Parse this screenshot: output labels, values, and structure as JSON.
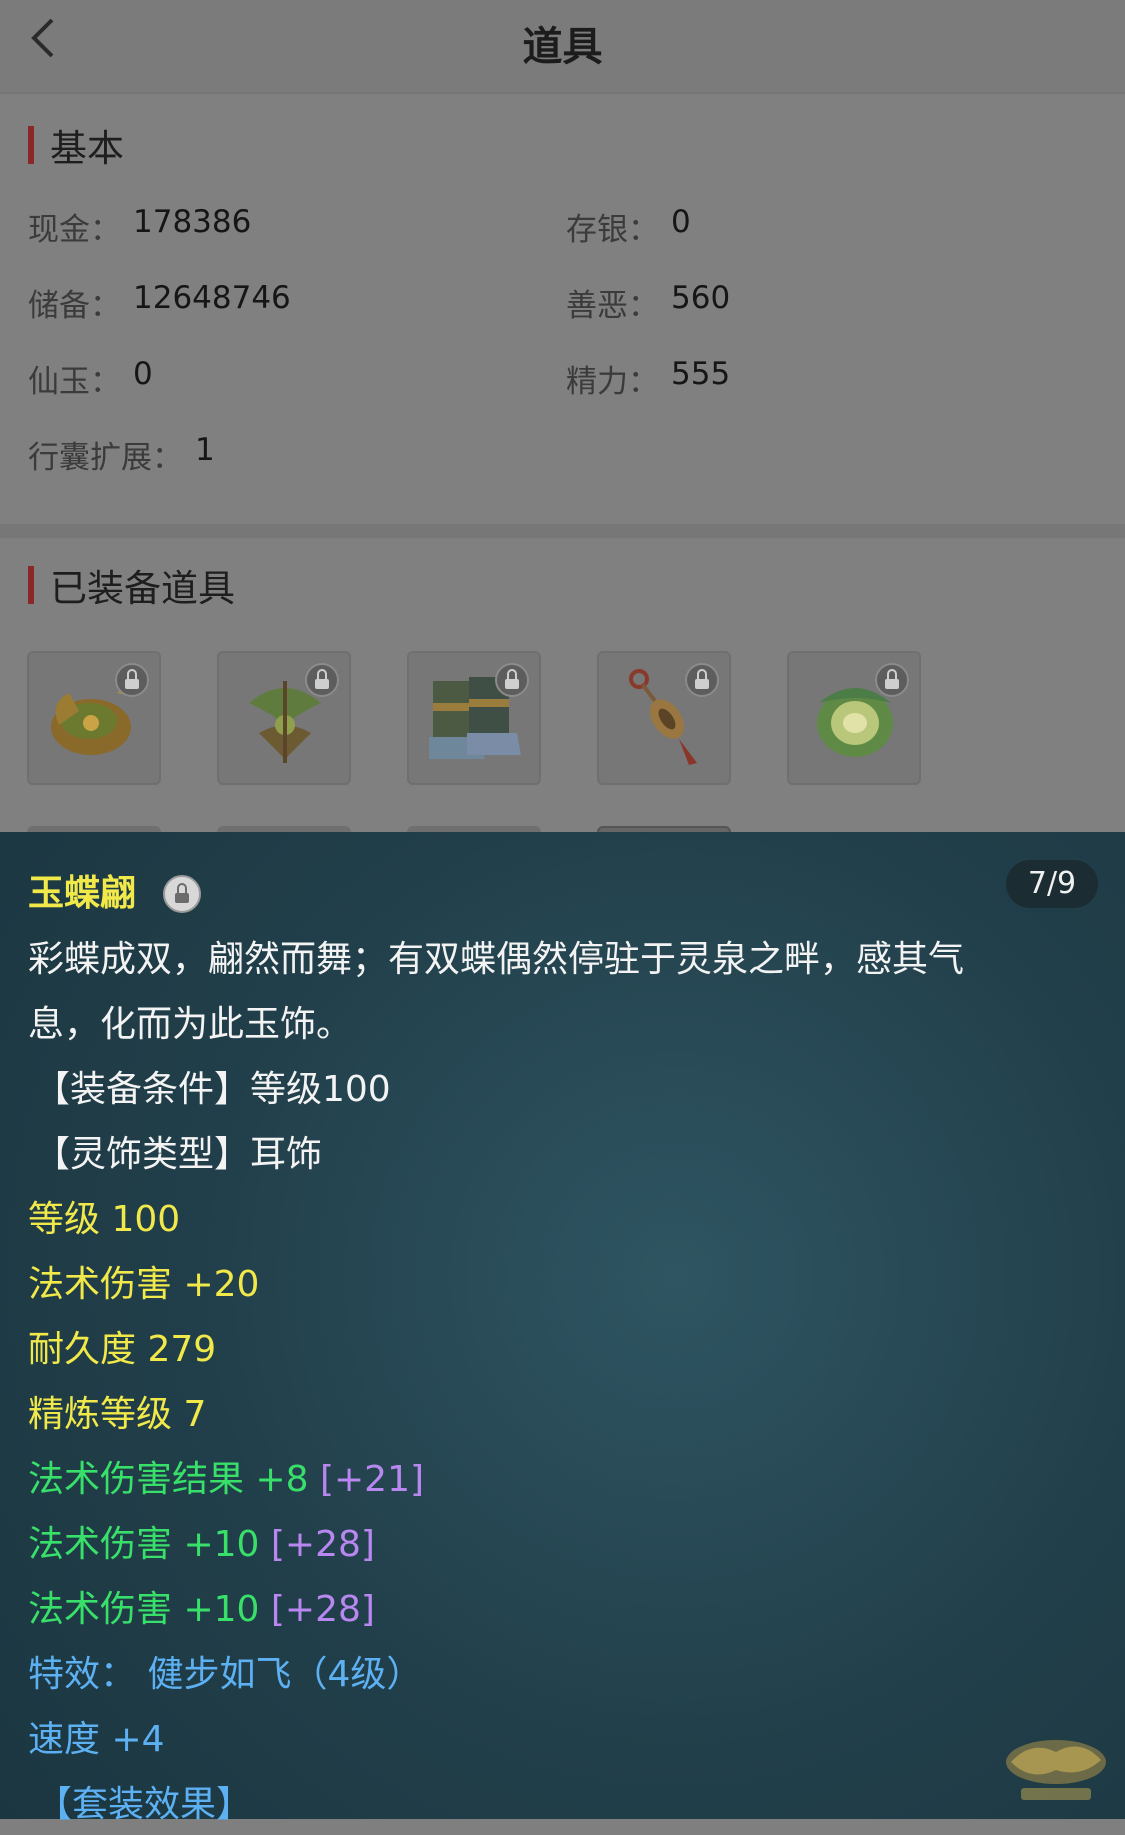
{
  "header": {
    "title": "道具",
    "back_icon": "chevron-left-icon"
  },
  "basic": {
    "section_title": "基本",
    "fields": [
      {
        "label": "现金：",
        "value": "178386"
      },
      {
        "label": "存银：",
        "value": "0"
      },
      {
        "label": "储备：",
        "value": "12648746"
      },
      {
        "label": "善恶：",
        "value": "560"
      },
      {
        "label": "仙玉：",
        "value": "0"
      },
      {
        "label": "精力：",
        "value": "555"
      },
      {
        "label": "行囊扩展：",
        "value": "1"
      }
    ]
  },
  "equipped": {
    "section_title": "已装备道具",
    "items": [
      {
        "icon": "helmet-icon",
        "locked": true
      },
      {
        "icon": "necklace-icon",
        "locked": true
      },
      {
        "icon": "boots-icon",
        "locked": true
      },
      {
        "icon": "earring-icon",
        "locked": true
      },
      {
        "icon": "jade-orb-icon",
        "locked": true
      }
    ]
  },
  "popup": {
    "item_name": "玉蝶翩",
    "pager": "7/9",
    "description_line1": "彩蝶成双，翩然而舞；有双蝶偶然停驻于灵泉之畔，感其气",
    "description_line2": "息，化而为此玉饰。",
    "equip_condition": "【装备条件】等级100",
    "ornament_type": "【灵饰类型】耳饰",
    "level": "等级 100",
    "magic_damage": "法术伤害 +20",
    "durability": "耐久度 279",
    "refine_level": "精炼等级 7",
    "attr1_text": "法术伤害结果 +8",
    "attr1_bonus": "[+21]",
    "attr2_text": "法术伤害 +10",
    "attr2_bonus": "[+28]",
    "attr3_text": "法术伤害 +10",
    "attr3_bonus": "[+28]",
    "special_effect": "特效：  健步如飞（4级）",
    "speed": "速度 +4",
    "set_effect": "【套装效果】"
  },
  "colors": {
    "yellow": "#f1e84a",
    "green": "#38e06a",
    "purple": "#b887f0",
    "blue": "#5db1f3",
    "popup_bg": "#213f4a",
    "accent_bar": "#8a2727"
  }
}
